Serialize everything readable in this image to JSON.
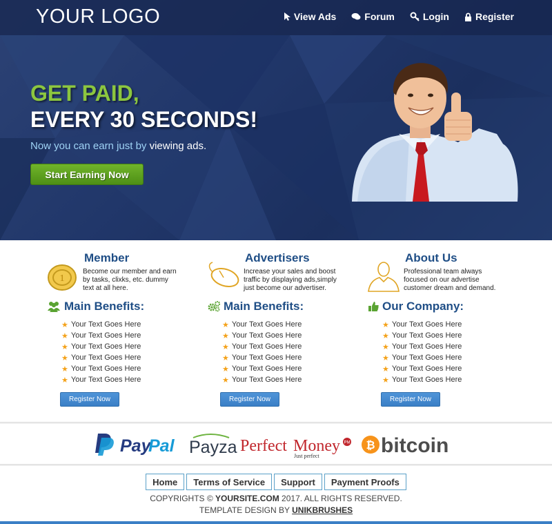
{
  "header": {
    "logo": "YOUR LOGO",
    "nav": [
      {
        "label": "View Ads",
        "icon": "cursor-icon"
      },
      {
        "label": "Forum",
        "icon": "chat-icon"
      },
      {
        "label": "Login",
        "icon": "key-icon"
      },
      {
        "label": "Register",
        "icon": "lock-icon"
      }
    ]
  },
  "hero": {
    "headline_line1": "GET PAID,",
    "headline_line2": "EVERY 30 SECONDS!",
    "sub_text_plain": "Now you can earn just by ",
    "sub_text_strong": "viewing ads.",
    "cta_label": "Start Earning Now"
  },
  "columns": [
    {
      "title": "Member",
      "icon": "coin-icon",
      "description": "Become our member and earn by tasks, clixks, etc. dummy text at all here.",
      "benefit_title": "Main Benefits:",
      "benefit_icon": "users-icon",
      "items": [
        "Your Text Goes Here",
        "Your Text Goes Here",
        "Your Text Goes Here",
        "Your Text Goes Here",
        "Your Text Goes Here",
        "Your Text Goes Here"
      ],
      "button": "Register Now"
    },
    {
      "title": "Advertisers",
      "icon": "mouse-icon",
      "description": "Increase your sales and boost traffic by displaying ads,simply just become our advertiser.",
      "benefit_title": "Main Benefits:",
      "benefit_icon": "gears-icon",
      "items": [
        "Your Text Goes Here",
        "Your Text Goes Here",
        "Your Text Goes Here",
        "Your Text Goes Here",
        "Your Text Goes Here",
        "Your Text Goes Here"
      ],
      "button": "Register Now"
    },
    {
      "title": "About Us",
      "icon": "person-icon",
      "description": "Professional team always focused on our advertise customer dream and demand.",
      "benefit_title": "Our Company:",
      "benefit_icon": "thumbs-up-icon",
      "items": [
        "Your Text Goes Here",
        "Your Text Goes Here",
        "Your Text Goes Here",
        "Your Text Goes Here",
        "Your Text Goes Here",
        "Your Text Goes Here"
      ],
      "button": "Register Now"
    }
  ],
  "payments": {
    "paypal_a": "Pay",
    "paypal_b": "Pal",
    "payza": "Payza",
    "pm_a": "Perfect",
    "pm_b": "Money",
    "pm_tag": "Just perfect",
    "pm_badge": "PM",
    "bitcoin": "bitcoin",
    "bitcoin_symbol": "₿"
  },
  "footer": {
    "links": [
      "Home",
      "Terms of Service",
      "Support",
      "Payment Proofs"
    ],
    "copyright_prefix": "COPYRIGHTS © ",
    "copyright_site": "YOURSITE.COM",
    "copyright_suffix": " 2017. ALL RIGHTS RESERVED.",
    "design_prefix": "TEMPLATE DESIGN BY ",
    "design_by": "UNIKBRUSHES"
  },
  "colors": {
    "hero_bg": "#21376a",
    "headline_green": "#8cc63f",
    "cta_green": "#5fa11f",
    "title_blue": "#1f4e86",
    "button_blue": "#3a7fc6",
    "star_orange": "#f4a21a",
    "paypal_dark": "#253b80",
    "paypal_light": "#179bd7",
    "pm_red": "#c1272d",
    "bitcoin_orange": "#f7931a"
  }
}
